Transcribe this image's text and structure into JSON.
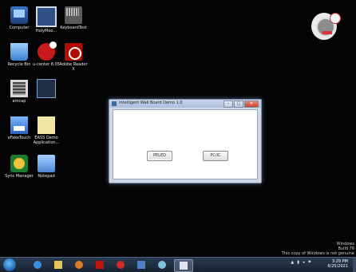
{
  "desktop": {
    "icons": [
      {
        "label": "Computer"
      },
      {
        "label": "HolyMoo..."
      },
      {
        "label": "KeyboardTest"
      },
      {
        "label": "Recycle Bin"
      },
      {
        "label": "u-center 8.05"
      },
      {
        "label": "Adobe Reader X"
      },
      {
        "label": "amcap"
      },
      {
        "label": ""
      },
      {
        "label": "eFakeTouch"
      },
      {
        "label": "EASS Demo Application..."
      },
      {
        "label": "Sync Manager"
      },
      {
        "label": "Notepad"
      }
    ]
  },
  "dialog": {
    "title": "Intelligent Wall Board Demo 1.0",
    "buttons": {
      "first": "PELED",
      "second": "PC/IC"
    },
    "controls": {
      "minimize": "–",
      "maximize": "□",
      "close": "✕"
    }
  },
  "watermark": {
    "line1": "Windows",
    "line2": "Build 76",
    "line3": "This copy of Windows is not genuine"
  },
  "taskbar": {
    "time": "3:29 PM",
    "date": "6/25/2021",
    "tray_arrow": "▲",
    "items": [
      "ie",
      "explorer",
      "media",
      "adobe",
      "ucenter",
      "demo",
      "paint",
      "dialog"
    ]
  },
  "icon_names": {
    "start": "windows-start-icon",
    "gadget": "desktop-gadget-icon"
  }
}
